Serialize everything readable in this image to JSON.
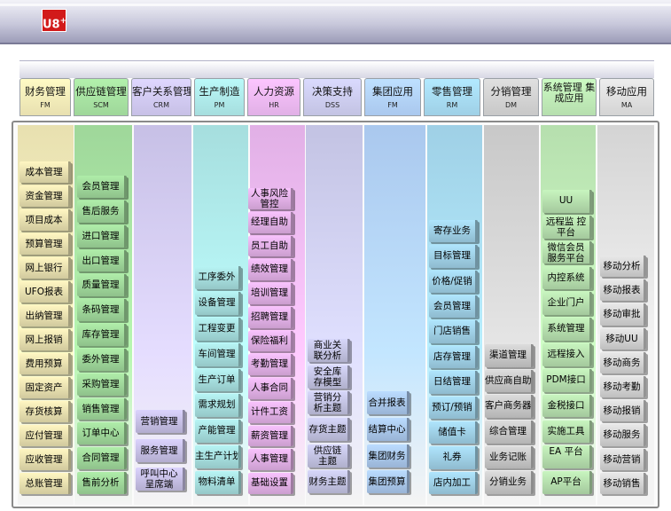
{
  "header": {
    "logo_text": "U8",
    "logo_sup": "+"
  },
  "modules": [
    {
      "name": "财务管理",
      "code": "FM",
      "color": "#e8e0b0",
      "items": [
        "成本管理",
        "资金管理",
        "项目成本",
        "预算管理",
        "网上银行",
        "UFO报表",
        "出纳管理",
        "网上报销",
        "费用预算",
        "固定资产",
        "存货核算",
        "应付管理",
        "应收管理",
        "总账管理"
      ]
    },
    {
      "name": "供应链管理",
      "code": "SCM",
      "color": "#9fd79a",
      "items": [
        "会员管理",
        "售后服务",
        "进口管理",
        "出口管理",
        "质量管理",
        "条码管理",
        "库存管理",
        "委外管理",
        "采购管理",
        "销售管理",
        "订单中心",
        "合同管理",
        "售前分析"
      ]
    },
    {
      "name": "客户关系管理",
      "code": "CRM",
      "color": "#c7c0e6",
      "items": [
        "营销管理",
        "服务管理",
        "呼叫中心 呈席端"
      ]
    },
    {
      "name": "生产制造",
      "code": "PM",
      "color": "#a6dede",
      "items": [
        "工序委外",
        "设备管理",
        "工程变更",
        "车间管理",
        "生产订单",
        "需求规划",
        "产能管理",
        "主生产计划",
        "物料清单"
      ]
    },
    {
      "name": "人力资源",
      "code": "HR",
      "color": "#e1b0e6",
      "items": [
        "人事风险 管控",
        "经理自助",
        "员工自助",
        "绩效管理",
        "培训管理",
        "招聘管理",
        "保险福利",
        "考勤管理",
        "人事合同",
        "计件工资",
        "薪资管理",
        "人事管理",
        "基础设置"
      ]
    },
    {
      "name": "决策支持",
      "code": "DSS",
      "color": "#c3c3e3",
      "items": [
        "商业关 联分析",
        "安全库 存模型",
        "营销分 析主题",
        "存货主题",
        "供应链 主题",
        "财务主题"
      ]
    },
    {
      "name": "集团应用",
      "code": "FM",
      "color": "#aac8ee",
      "items": [
        "合并报表",
        "结算中心",
        "集团财务",
        "集团预算"
      ]
    },
    {
      "name": "零售管理",
      "code": "RM",
      "color": "#9fd0e6",
      "items": [
        "寄存业务",
        "目标管理",
        "价格/促销",
        "会员管理",
        "门店销售",
        "店存管理",
        "日结管理",
        "预订/预销",
        "储值卡",
        "礼券",
        "店内加工"
      ]
    },
    {
      "name": "分销管理",
      "code": "DM",
      "color": "#c8c8c8",
      "items": [
        "渠道管理",
        "供应商自助",
        "客户商务器",
        "综合管理",
        "业务记账",
        "分销业务"
      ]
    },
    {
      "name": "系统管理 集成应用",
      "code": "",
      "color": "#b6dfae",
      "items": [
        "UU",
        "远程监 控平台",
        "微信会员 服务平台",
        "内控系统",
        "企业门户",
        "系统管理",
        "远程接入",
        "PDM接口",
        "金税接口",
        "实施工具",
        "EA 平台",
        "AP平台"
      ]
    },
    {
      "name": "移动应用",
      "code": "MA",
      "color": "#d4d4d4",
      "items": [
        "移动分析",
        "移动报表",
        "移动审批",
        "移动UU",
        "移动商务",
        "移动考勤",
        "移动报销",
        "移动服务",
        "移动营销",
        "移动销售"
      ]
    }
  ]
}
